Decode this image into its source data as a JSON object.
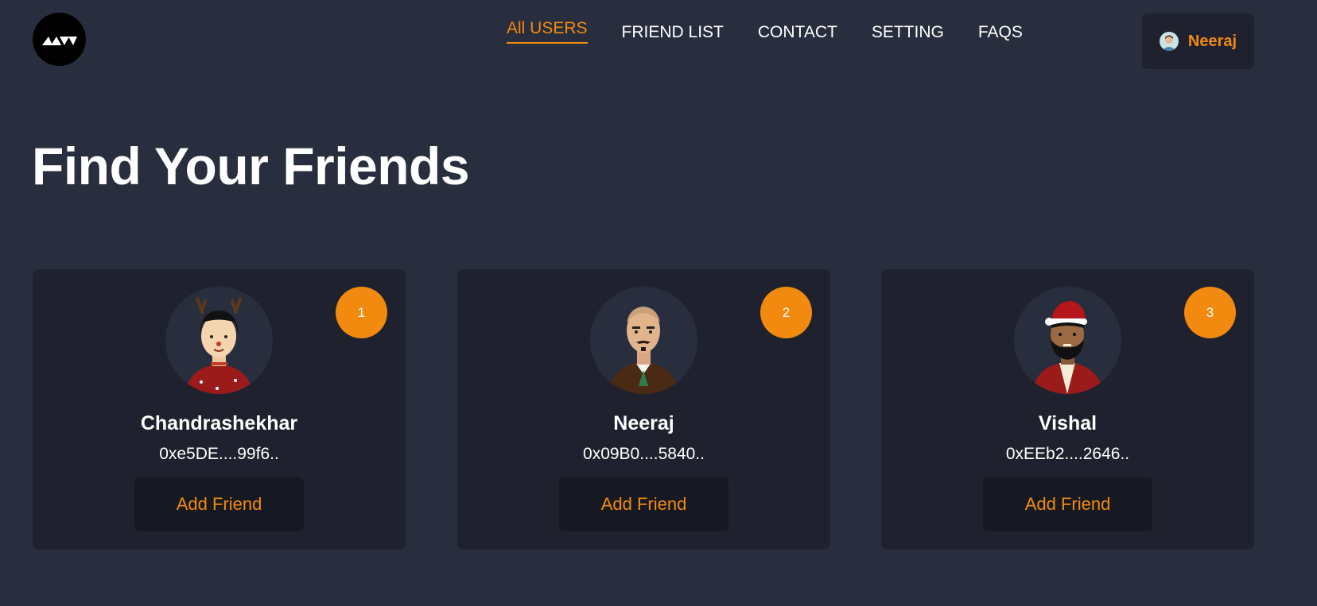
{
  "header": {
    "logo_icon": "logo-mark",
    "nav": [
      {
        "label": "All USERS",
        "active": true
      },
      {
        "label": "FRIEND LIST",
        "active": false
      },
      {
        "label": "CONTACT",
        "active": false
      },
      {
        "label": "SETTING",
        "active": false
      },
      {
        "label": "FAQS",
        "active": false
      }
    ],
    "user": {
      "name": "Neeraj",
      "avatar_icon": "user-avatar-icon"
    }
  },
  "main": {
    "title": "Find Your Friends",
    "cards": [
      {
        "index": "1",
        "name": "Chandrashekhar",
        "address": "0xe5DE....99f6..",
        "button_label": "Add Friend",
        "avatar_icon": "reindeer-girl-avatar"
      },
      {
        "index": "2",
        "name": "Neeraj",
        "address": "0x09B0....5840..",
        "button_label": "Add Friend",
        "avatar_icon": "bald-man-avatar"
      },
      {
        "index": "3",
        "name": "Vishal",
        "address": "0xEEb2....2646..",
        "button_label": "Add Friend",
        "avatar_icon": "santa-hat-man-avatar"
      }
    ]
  },
  "colors": {
    "background": "#292e3e",
    "card": "#1f222e",
    "accent": "#f28a0f",
    "button": "#161921"
  }
}
